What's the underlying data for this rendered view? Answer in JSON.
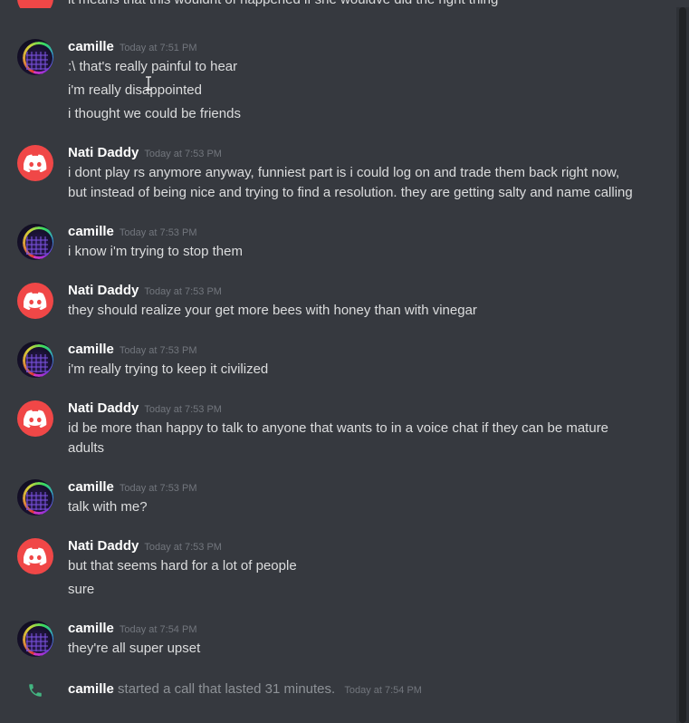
{
  "top_partial": {
    "text": "it means that this wouldnt of happened if she wouldve did the right thing"
  },
  "messages": [
    {
      "author": "camille",
      "time": "Today at 7:51 PM",
      "lines": [
        ":\\ that's really painful to hear",
        "i'm really disappointed",
        "i thought we could be friends"
      ]
    },
    {
      "author": "Nati Daddy",
      "time": "Today at 7:53 PM",
      "lines": [
        "i dont play rs anymore anyway, funniest part is i could log on and trade them back right now,",
        "but instead of being nice and trying to find a resolution. they are getting salty and name calling"
      ]
    },
    {
      "author": "camille",
      "time": "Today at 7:53 PM",
      "lines": [
        "i know i'm trying to stop them"
      ]
    },
    {
      "author": "Nati Daddy",
      "time": "Today at 7:53 PM",
      "lines": [
        "they should realize your get more bees with honey than with vinegar"
      ]
    },
    {
      "author": "camille",
      "time": "Today at 7:53 PM",
      "lines": [
        "i'm really trying to keep it civilized"
      ]
    },
    {
      "author": "Nati Daddy",
      "time": "Today at 7:53 PM",
      "lines": [
        "id be more than happy to talk to anyone that wants to in a voice chat if they can be mature",
        "adults"
      ]
    },
    {
      "author": "camille",
      "time": "Today at 7:53 PM",
      "lines": [
        "talk with me?"
      ]
    },
    {
      "author": "Nati Daddy",
      "time": "Today at 7:53 PM",
      "lines": [
        "but that seems hard for a lot of people",
        "sure"
      ]
    },
    {
      "author": "camille",
      "time": "Today at 7:54 PM",
      "lines": [
        "they're all super upset"
      ]
    }
  ],
  "call": {
    "author": "camille",
    "text": "started a call that lasted 31 minutes.",
    "time": "Today at 7:54 PM",
    "icon": "phone-icon",
    "icon_color": "#43b581"
  },
  "colors": {
    "background": "#36393f",
    "discord_red": "#f04747",
    "username": "#ffffff",
    "timestamp": "#72767d",
    "text": "#dcddde"
  }
}
